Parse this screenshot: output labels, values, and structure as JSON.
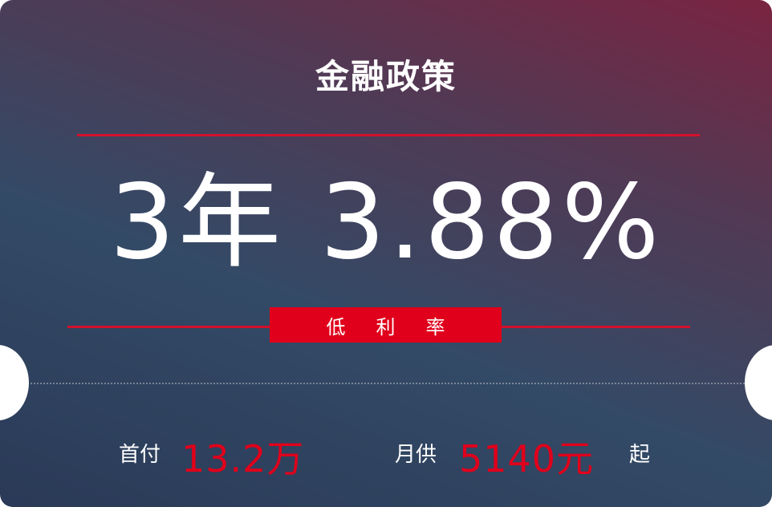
{
  "title": "金融政策",
  "headline": "3年 3.88%",
  "tag": "低利率",
  "down_payment": {
    "label": "首付",
    "value": "13.2万"
  },
  "monthly": {
    "label": "月供",
    "value": "5140元",
    "suffix": "起"
  },
  "colors": {
    "accent": "#e0001b",
    "line": "#d3112c",
    "text": "#ffffff"
  }
}
